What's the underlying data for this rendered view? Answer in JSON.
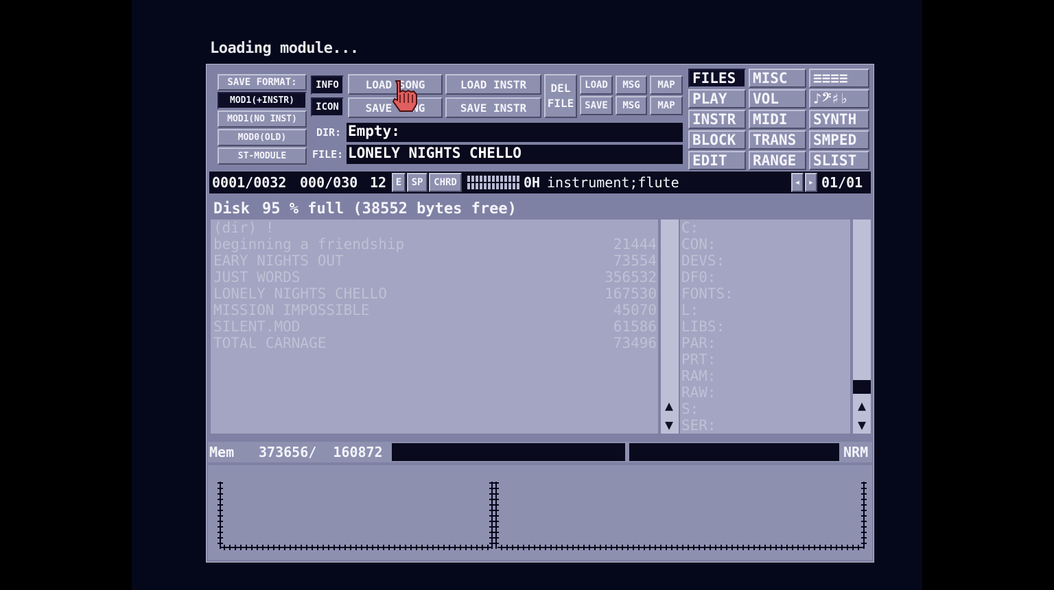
{
  "status_message": "Loading module...",
  "save_format": {
    "label": "SAVE FORMAT:",
    "options": [
      "MOD1(+INSTR)",
      "MOD1(NO INST)",
      "MOD0(OLD)",
      "ST-MODULE"
    ],
    "selected": "MOD1(+INSTR)"
  },
  "toggles": {
    "info": "INFO",
    "icon": "ICON"
  },
  "song_buttons": {
    "load_song": "LOAD SONG",
    "save_song": "SAVE SONG",
    "load_instr": "LOAD INSTR",
    "save_instr": "SAVE INSTR"
  },
  "del_file": {
    "line1": "DEL",
    "line2": "FILE"
  },
  "msg_map": {
    "load": "LOAD",
    "save": "SAVE",
    "msg": "MSG",
    "map": "MAP"
  },
  "fields": {
    "dir_label": "DIR:",
    "dir_value": "Empty:",
    "file_label": "FILE:",
    "file_value": "LONELY NIGHTS CHELLO"
  },
  "menu": [
    [
      "FILES",
      "MISC",
      "≡≡≡≡"
    ],
    [
      "PLAY",
      "VOL",
      "♪𝄢♯♭"
    ],
    [
      "INSTR",
      "MIDI",
      "SYNTH"
    ],
    [
      "BLOCK",
      "TRANS",
      "SMPED"
    ],
    [
      "EDIT",
      "RANGE",
      "SLIST"
    ]
  ],
  "menu_selected": "FILES",
  "info_bar": {
    "position": "0001/0032",
    "block": "000/030",
    "tempo": "12",
    "e": "E",
    "sp": "SP",
    "chrd": "CHRD",
    "inst_num": "0H",
    "inst_name": "instrument;flute",
    "page": "01/01"
  },
  "disk": {
    "label": "Disk",
    "percent": "95",
    "text": "95 % full (38552 bytes free)"
  },
  "files": [
    {
      "name": "(dir) !",
      "size": ""
    },
    {
      "name": "beginning a friendship",
      "size": "21444"
    },
    {
      "name": "EARY NIGHTS OUT",
      "size": "73554"
    },
    {
      "name": "JUST WORDS",
      "size": "356532"
    },
    {
      "name": "LONELY NIGHTS CHELLO",
      "size": "167530"
    },
    {
      "name": "MISSION IMPOSSIBLE",
      "size": "45070"
    },
    {
      "name": "SILENT.MOD",
      "size": "61586"
    },
    {
      "name": "TOTAL CARNAGE",
      "size": "73496"
    }
  ],
  "devices": [
    "C:",
    "CON:",
    "DEVS:",
    "DF0:",
    "FONTS:",
    "L:",
    "LIBS:",
    "PAR:",
    "PRT:",
    "RAM:",
    "RAW:",
    "S:",
    "SER:"
  ],
  "mem_bar": {
    "label": "Mem",
    "values": "373656/  160872",
    "mode": "NRM"
  },
  "colors": {
    "background": "#7f81a4",
    "dark": "#0a0a1e",
    "list_panel": "#a3a5c2"
  }
}
